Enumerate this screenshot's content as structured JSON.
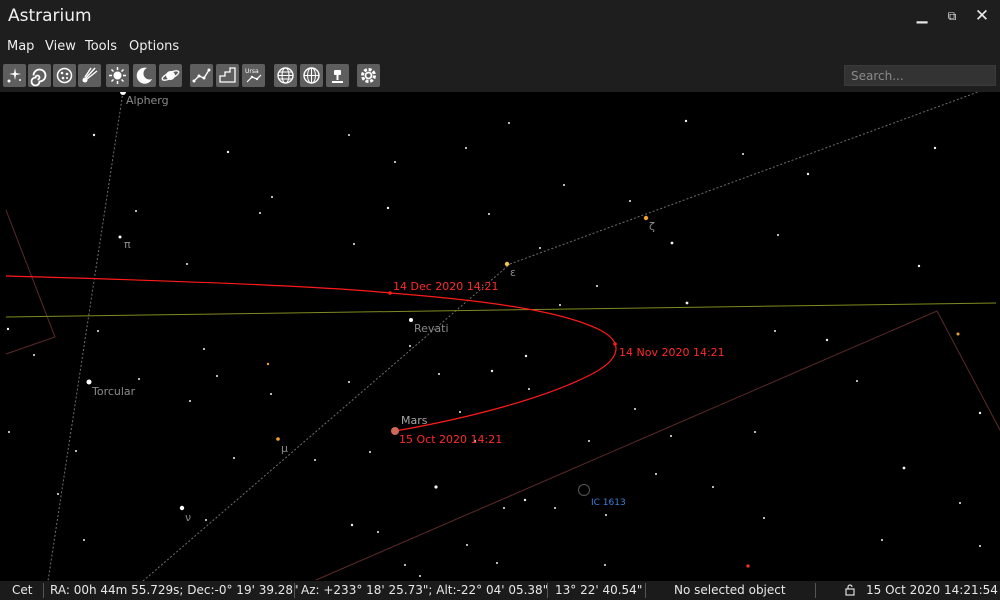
{
  "window": {
    "title": "Astrarium",
    "minimize": "▁",
    "restore": "⧉",
    "close": "✕"
  },
  "menu": [
    "Map",
    "View",
    "Tools",
    "Options"
  ],
  "toolbar": {
    "buttons": [
      "stars-icon",
      "galaxy-icon",
      "star-cluster-icon",
      "comet-icon",
      "sun-icon",
      "moon-icon",
      "planet-icon",
      "constellation-lines-icon",
      "constellation-borders-icon",
      "constellation-labels-icon",
      "equatorial-grid-icon",
      "horizontal-grid-icon",
      "telescope-icon",
      "settings-icon"
    ],
    "search_placeholder": "Search..."
  },
  "sky": {
    "star_labels": [
      {
        "id": "alpherg",
        "text": "Alpherg"
      },
      {
        "id": "pi",
        "text": "π"
      },
      {
        "id": "epsilon",
        "text": "ε"
      },
      {
        "id": "zeta",
        "text": "ζ"
      },
      {
        "id": "revati",
        "text": "Revati"
      },
      {
        "id": "torcular",
        "text": "Torcular"
      },
      {
        "id": "mu",
        "text": "μ"
      },
      {
        "id": "nu",
        "text": "ν"
      }
    ],
    "mars": {
      "label": "Mars",
      "track_color": "#ff1a1a",
      "dates": [
        "14 Dec 2020 14:21",
        "14 Nov 2020 14:21",
        "15 Oct 2020 14:21"
      ]
    },
    "deep_sky": {
      "label": "IC 1613",
      "color": "#3d7fd9"
    }
  },
  "status": {
    "constellation": "Cet",
    "equatorial": "RA: 00h 44m 55.729s; Dec:-0° 19' 39.28\"",
    "horizontal": "Az: +233° 18' 25.73\"; Alt:-22° 04' 05.38\"",
    "fov": "13° 22' 40.54\"",
    "selection": "No selected object",
    "datetime": "15 Oct 2020 14:21:54"
  }
}
